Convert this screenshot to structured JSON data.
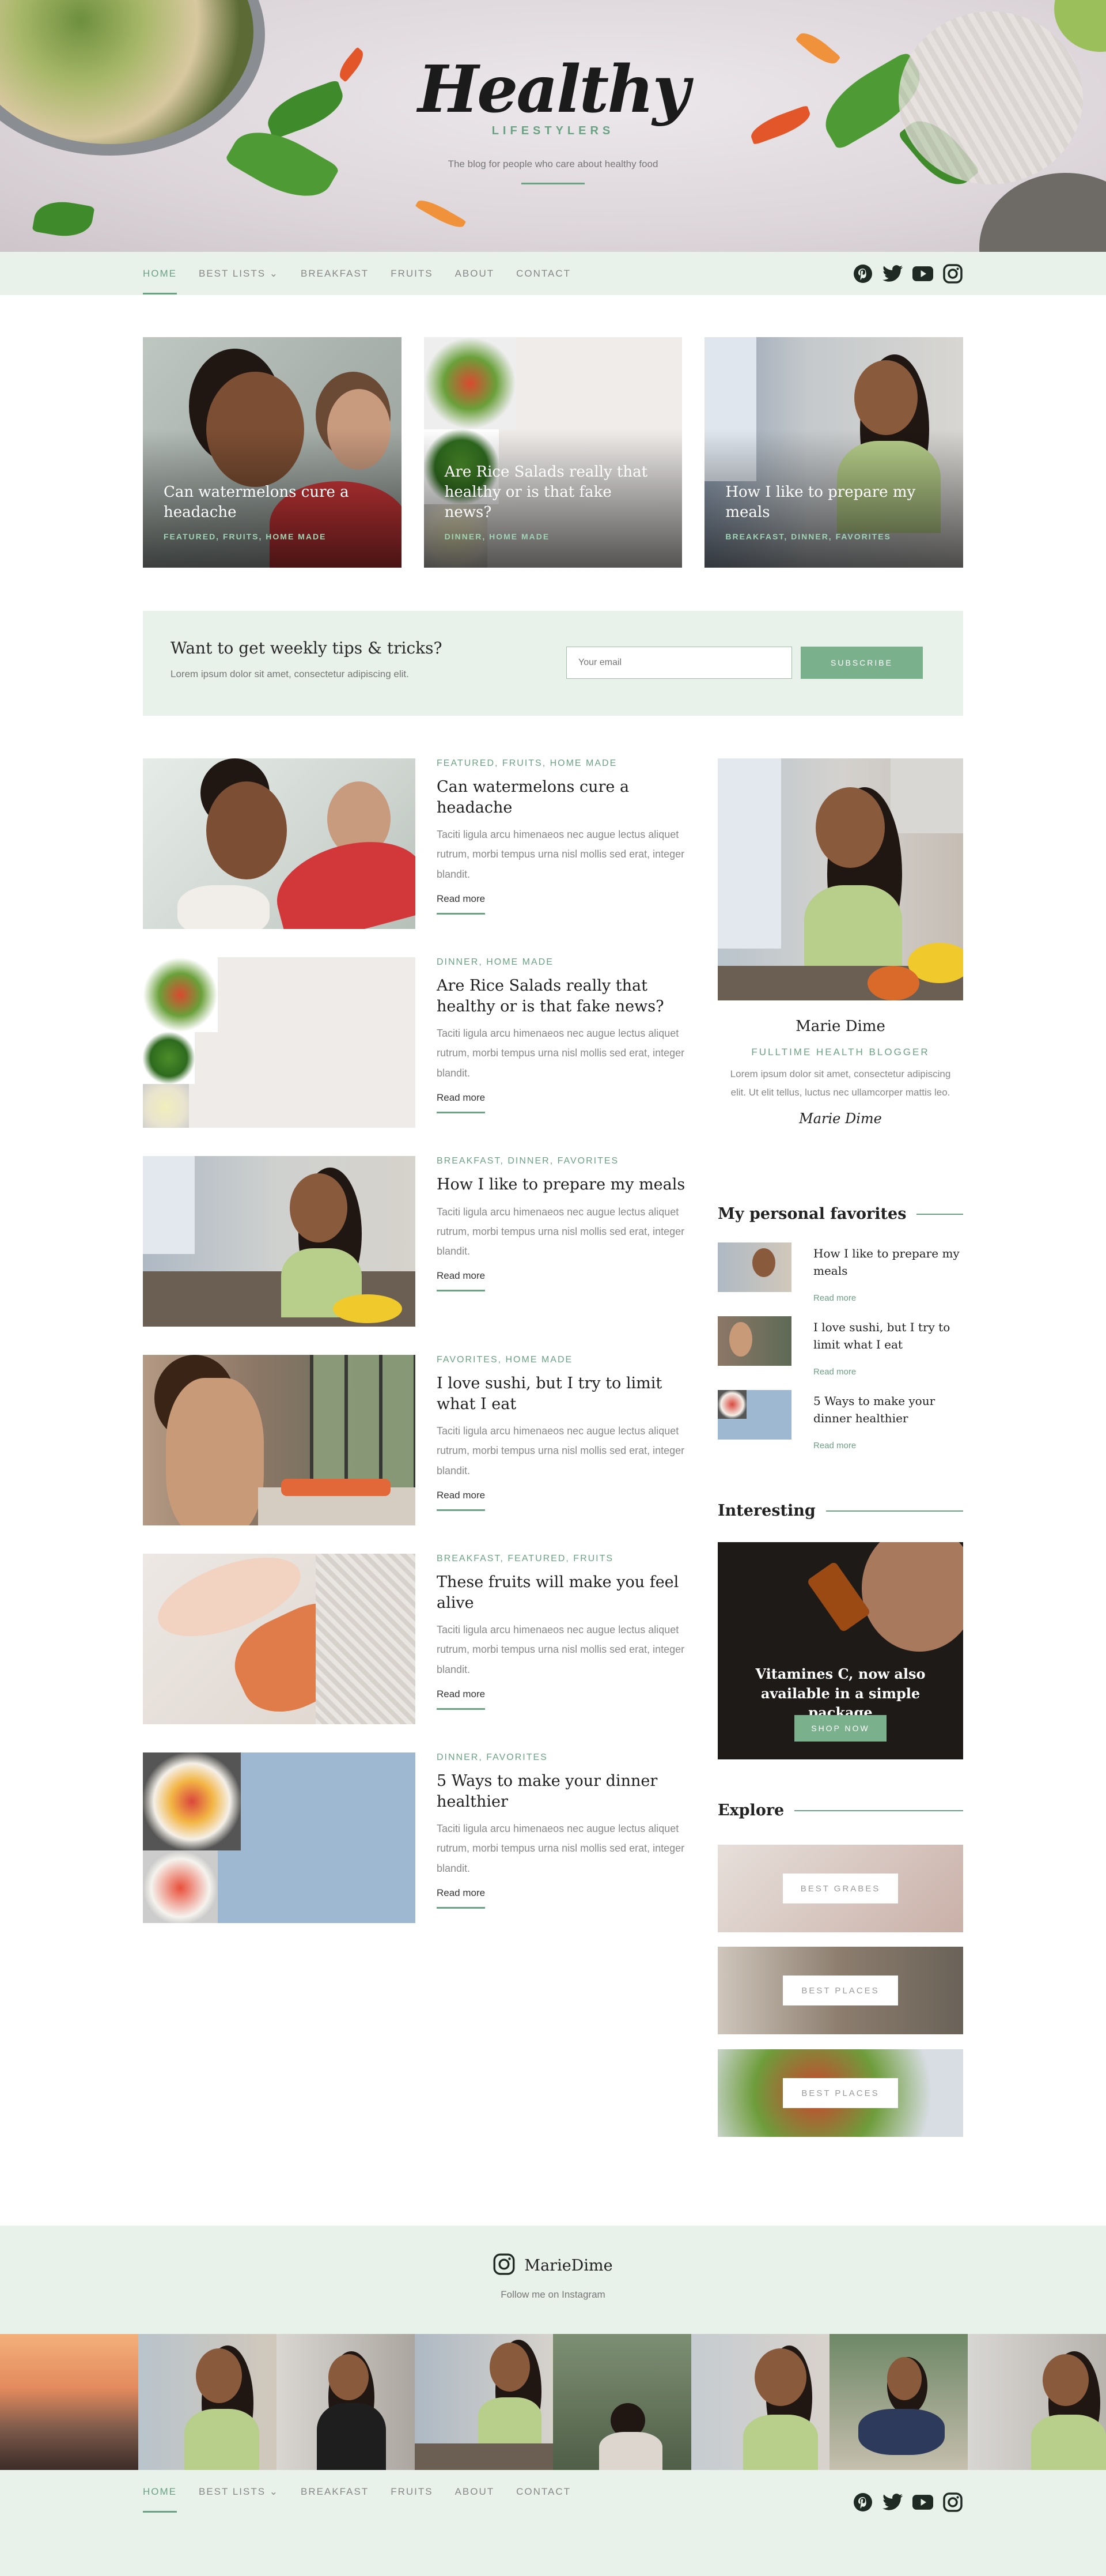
{
  "brand": {
    "logo": "Healthy",
    "sub": "LIFESTYLERS",
    "tagline": "The blog for people who care about healthy food"
  },
  "nav": {
    "items": [
      "HOME",
      "BEST LISTS",
      "BREAKFAST",
      "FRUITS",
      "ABOUT",
      "CONTACT"
    ],
    "dropdown_marker": "⌄",
    "social": [
      "pinterest-icon",
      "twitter-icon",
      "youtube-icon",
      "instagram-icon"
    ]
  },
  "featured": [
    {
      "title": "Can watermelons cure a headache",
      "tags": "FEATURED, FRUITS, HOME MADE"
    },
    {
      "title": "Are Rice Salads really that healthy or is that fake news?",
      "tags": "DINNER, HOME MADE"
    },
    {
      "title": "How I like to prepare my meals",
      "tags": "BREAKFAST, DINNER, FAVORITES"
    }
  ],
  "newsletter": {
    "title": "Want to get weekly tips & tricks?",
    "desc": "Lorem ipsum dolor sit amet, consectetur adipiscing elit.",
    "placeholder": "Your email",
    "button": "SUBSCRIBE"
  },
  "posts": [
    {
      "tags": "FEATURED, FRUITS, HOME MADE",
      "title": "Can watermelons cure a headache",
      "excerpt": "Taciti ligula arcu himenaeos nec augue lectus aliquet rutrum, morbi tempus urna nisl mollis sed erat, integer blandit.",
      "read": "Read more"
    },
    {
      "tags": "DINNER, HOME MADE",
      "title": "Are Rice Salads really that healthy or is that fake news?",
      "excerpt": "Taciti ligula arcu himenaeos nec augue lectus aliquet rutrum, morbi tempus urna nisl mollis sed erat, integer blandit.",
      "read": "Read more"
    },
    {
      "tags": "BREAKFAST, DINNER, FAVORITES",
      "title": "How I like to prepare my meals",
      "excerpt": "Taciti ligula arcu himenaeos nec augue lectus aliquet rutrum, morbi tempus urna nisl mollis sed erat, integer blandit.",
      "read": "Read more"
    },
    {
      "tags": "FAVORITES, HOME MADE",
      "title": "I love sushi, but I try to limit what I eat",
      "excerpt": "Taciti ligula arcu himenaeos nec augue lectus aliquet rutrum, morbi tempus urna nisl mollis sed erat, integer blandit.",
      "read": "Read more"
    },
    {
      "tags": "BREAKFAST, FEATURED, FRUITS",
      "title": "These fruits will make you feel alive",
      "excerpt": "Taciti ligula arcu himenaeos nec augue lectus aliquet rutrum, morbi tempus urna nisl mollis sed erat, integer blandit.",
      "read": "Read more"
    },
    {
      "tags": "DINNER, FAVORITES",
      "title": "5 Ways to make your dinner healthier",
      "excerpt": "Taciti ligula arcu himenaeos nec augue lectus aliquet rutrum, morbi tempus urna nisl mollis sed erat, integer blandit.",
      "read": "Read more"
    }
  ],
  "author": {
    "name": "Marie Dime",
    "role": "FULLTIME HEALTH BLOGGER",
    "bio": "Lorem ipsum dolor sit amet, consectetur adipiscing elit. Ut elit tellus, luctus nec ullamcorper mattis leo.",
    "signature": "Marie Dime"
  },
  "favorites": {
    "title": "My personal favorites",
    "items": [
      {
        "title": "How I like to prepare my meals",
        "read": "Read more"
      },
      {
        "title": "I love sushi, but I try to limit what I eat",
        "read": "Read more"
      },
      {
        "title": "5 Ways to make your dinner healthier",
        "read": "Read more"
      }
    ]
  },
  "interesting": {
    "title": "Interesting",
    "text": "Vitamines C, now also available in a simple package",
    "button": "SHOP NOW"
  },
  "explore": {
    "title": "Explore",
    "items": [
      "BEST GRABES",
      "BEST PLACES",
      "BEST PLACES"
    ]
  },
  "instagram": {
    "user": "MarieDime",
    "sub": "Follow me on Instagram"
  },
  "colors": {
    "accent": "#6aa383",
    "button": "#7bb08d",
    "band": "#e8f1ea"
  }
}
